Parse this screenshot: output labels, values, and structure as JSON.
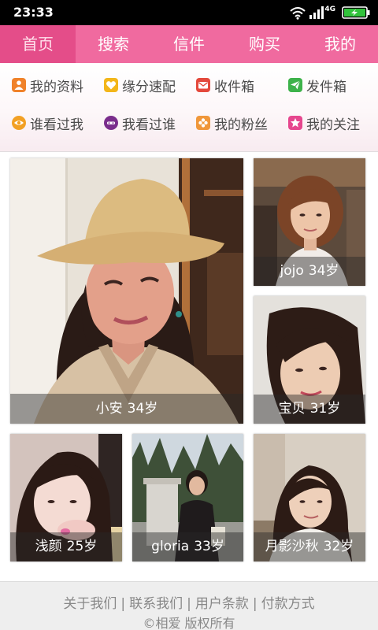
{
  "status_bar": {
    "time": "23:33",
    "network_type": "4G",
    "icons": [
      "wifi-icon",
      "signal-icon",
      "battery-charging-icon"
    ]
  },
  "theme": {
    "accent": "#f06a9f",
    "accent_active": "#e44d89"
  },
  "nav": {
    "tabs": [
      {
        "label": "首页",
        "active": true
      },
      {
        "label": "搜索",
        "active": false
      },
      {
        "label": "信件",
        "active": false
      },
      {
        "label": "购买",
        "active": false
      },
      {
        "label": "我的",
        "active": false
      }
    ]
  },
  "quick_links": [
    {
      "label": "我的资料",
      "icon": "profile-icon",
      "color": "#f0822a"
    },
    {
      "label": "缘分速配",
      "icon": "match-icon",
      "color": "#f3b61a"
    },
    {
      "label": "收件箱",
      "icon": "inbox-icon",
      "color": "#e4493c"
    },
    {
      "label": "发件箱",
      "icon": "outbox-icon",
      "color": "#3db24a"
    },
    {
      "label": "谁看过我",
      "icon": "visitors-icon",
      "color": "#f2a024"
    },
    {
      "label": "我看过谁",
      "icon": "visited-icon",
      "color": "#7a2d8c"
    },
    {
      "label": "我的粉丝",
      "icon": "fans-icon",
      "color": "#f0973a"
    },
    {
      "label": "我的关注",
      "icon": "following-icon",
      "color": "#e6468e"
    }
  ],
  "profiles": [
    {
      "name": "小安",
      "age": "34岁"
    },
    {
      "name": "jojo",
      "age": "34岁"
    },
    {
      "name": "宝贝",
      "age": "31岁"
    },
    {
      "name": "浅颜",
      "age": "25岁"
    },
    {
      "name": "gloria",
      "age": "33岁"
    },
    {
      "name": "月影沙秋",
      "age": "32岁"
    }
  ],
  "footer": {
    "links": [
      "关于我们",
      "联系我们",
      "用户条款",
      "付款方式"
    ],
    "separator": "|",
    "copyright": "©相爱 版权所有"
  }
}
